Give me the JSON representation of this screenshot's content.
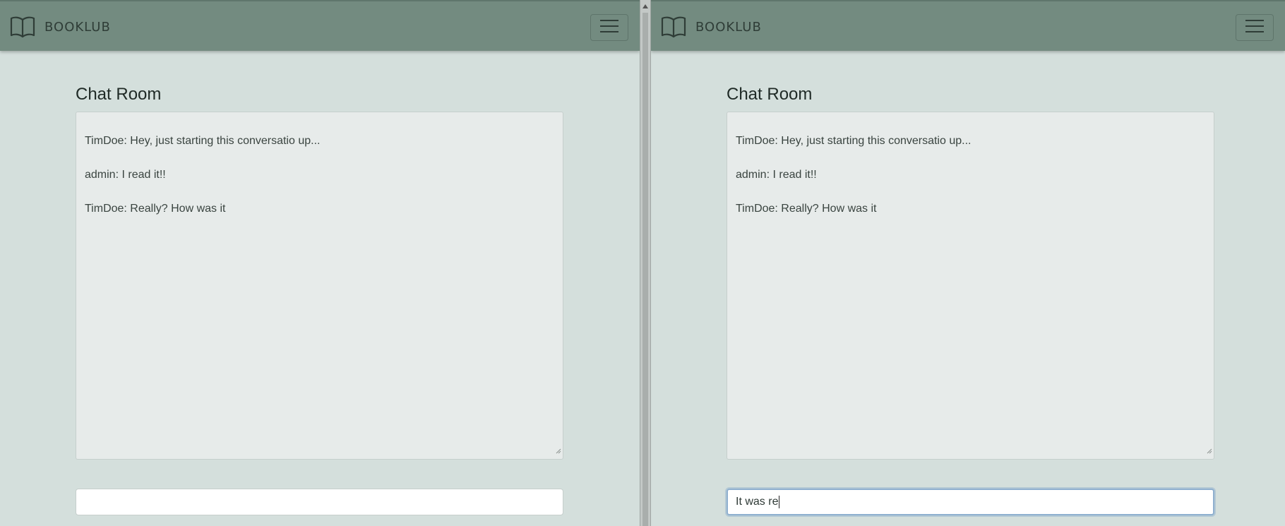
{
  "app": {
    "brand": "BOOKLUB",
    "brand_icon": "open-book-icon",
    "menu_icon": "hamburger-menu-icon"
  },
  "chat": {
    "title": "Chat Room",
    "messages": [
      "TimDoe: Hey, just starting this conversatio up...",
      "admin: I read it!!",
      "TimDoe: Really? How was it"
    ]
  },
  "left_window": {
    "input_value": ""
  },
  "right_window": {
    "input_value": "It was re"
  },
  "colors": {
    "navbar": "#738b80",
    "page_background": "#d4dfdc",
    "chat_log_background": "#e7ebea",
    "focus_ring": "#8fb0cf"
  }
}
